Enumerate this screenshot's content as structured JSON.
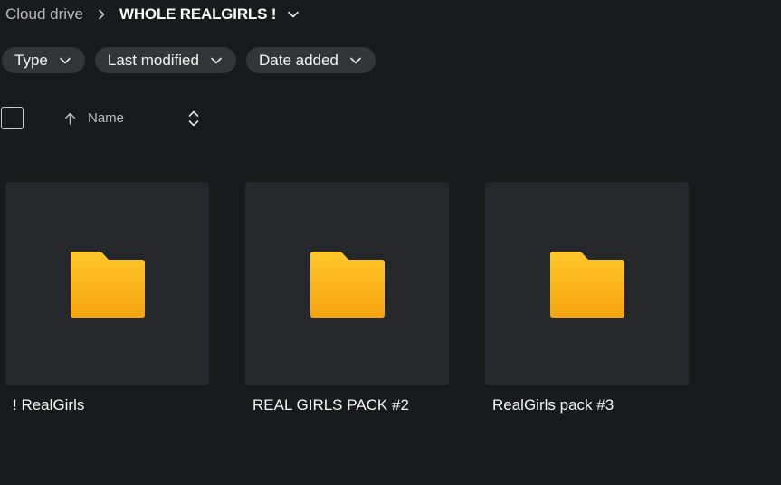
{
  "breadcrumb": {
    "root": "Cloud drive",
    "current": "WHOLE REALGIRLS !"
  },
  "filters": [
    {
      "label": "Type"
    },
    {
      "label": "Last modified"
    },
    {
      "label": "Date added"
    }
  ],
  "sort": {
    "label": "Name",
    "direction": "ascending"
  },
  "items": [
    {
      "name": "! RealGirls",
      "kind": "folder"
    },
    {
      "name": "REAL GIRLS PACK #2",
      "kind": "folder"
    },
    {
      "name": "RealGirls pack #3",
      "kind": "folder"
    }
  ],
  "colors": {
    "background": "#181a1b",
    "card": "#25272a",
    "chip": "#333537",
    "folder_top": "#ffc72b",
    "folder_bottom": "#f6a40f"
  }
}
